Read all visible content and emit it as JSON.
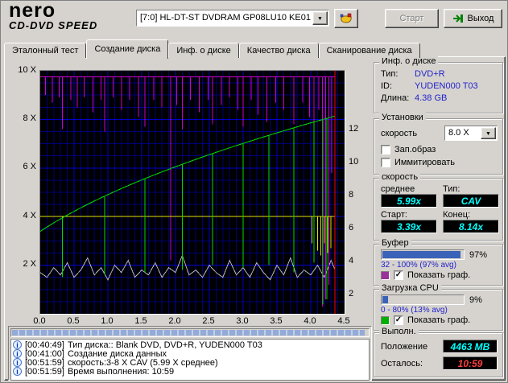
{
  "header": {
    "logo_line1": "nero",
    "logo_line2": "CD-DVD SPEED",
    "drive_combo": {
      "value": "[7:0]   HL-DT-ST DVDRAM GP08LU10 KE01"
    },
    "start_label": "Старт",
    "exit_label": "Выход"
  },
  "tabs": [
    {
      "label": "Эталонный тест",
      "active": false
    },
    {
      "label": "Создание диска",
      "active": true
    },
    {
      "label": "Инф. о диске",
      "active": false
    },
    {
      "label": "Качество диска",
      "active": false
    },
    {
      "label": "Сканирование диска",
      "active": false
    }
  ],
  "chart_data": {
    "type": "line",
    "x_range": [
      0,
      4.5
    ],
    "y_range": [
      0,
      10
    ],
    "left_ticks": [
      "10 X",
      "8 X",
      "6 X",
      "4 X",
      "2 X"
    ],
    "bottom_ticks": [
      "0.0",
      "0.5",
      "1.0",
      "1.5",
      "2.0",
      "2.5",
      "3.0",
      "3.5",
      "4.0",
      "4.5"
    ],
    "right_ticks": [
      "12",
      "10",
      "8",
      "6",
      "4",
      "2"
    ],
    "grid": {
      "minor": "#000078",
      "major": "#0000c8"
    },
    "cursor": {
      "x": 4.36,
      "color": "#ff0000"
    },
    "series": [
      {
        "name": "cpu-usage",
        "color": "#b4b4b4",
        "step": 0.1,
        "values": [
          1.7,
          1.5,
          1.9,
          1.6,
          2.1,
          1.5,
          1.8,
          2.3,
          1.6,
          1.9,
          1.4,
          2.0,
          1.7,
          2.2,
          1.5,
          1.8,
          1.6,
          2.1,
          1.5,
          1.9,
          1.7,
          2.4,
          1.6,
          1.8,
          1.5,
          2.0,
          1.7,
          1.5,
          2.2,
          1.6,
          1.9,
          1.5,
          2.1,
          1.7,
          1.4,
          2.0,
          1.6,
          2.3,
          1.5,
          1.8,
          1.6,
          2.0,
          1.5,
          2.2,
          1.8
        ]
      },
      {
        "name": "buffer-level",
        "color": "#cc00cc",
        "baseline": 9.75,
        "spikes": [
          [
            0.08,
            9.0
          ],
          [
            0.18,
            8.7
          ],
          [
            0.28,
            8.9
          ],
          [
            0.33,
            7.6
          ],
          [
            0.45,
            8.8
          ],
          [
            0.55,
            8.5
          ],
          [
            0.65,
            8.9
          ],
          [
            0.78,
            8.3
          ],
          [
            0.9,
            8.8
          ],
          [
            0.95,
            7.5
          ],
          [
            1.08,
            8.9
          ],
          [
            1.2,
            8.4
          ],
          [
            1.32,
            8.8
          ],
          [
            1.45,
            8.1
          ],
          [
            1.55,
            7.7
          ],
          [
            1.68,
            8.8
          ],
          [
            1.8,
            8.5
          ],
          [
            1.93,
            2.2
          ],
          [
            2.02,
            8.6
          ],
          [
            2.1,
            7.6
          ],
          [
            2.22,
            8.8
          ],
          [
            2.35,
            8.3
          ],
          [
            2.48,
            8.8
          ],
          [
            2.55,
            7.8
          ],
          [
            2.68,
            8.6
          ],
          [
            2.8,
            8.9
          ],
          [
            2.92,
            8.4
          ],
          [
            3.0,
            7.7
          ],
          [
            3.12,
            8.8
          ],
          [
            3.22,
            8.2
          ],
          [
            3.35,
            7.9
          ],
          [
            3.48,
            8.7
          ],
          [
            3.6,
            8.4
          ],
          [
            3.75,
            7.8
          ],
          [
            3.88,
            8.7
          ],
          [
            3.98,
            8.1
          ],
          [
            4.05,
            7.5
          ],
          [
            4.12,
            8.4
          ],
          [
            4.17,
            0.3
          ],
          [
            4.22,
            0.6
          ],
          [
            4.27,
            1.2
          ],
          [
            4.31,
            5.8
          ]
        ]
      },
      {
        "name": "reference-speed",
        "color": "#e0e000",
        "baseline": 4.0,
        "spikes": [
          [
            0.33,
            3.1
          ],
          [
            0.95,
            3.1
          ],
          [
            1.55,
            3.2
          ],
          [
            2.1,
            3.1
          ],
          [
            2.55,
            3.2
          ],
          [
            3.0,
            3.1
          ],
          [
            3.38,
            3.2
          ],
          [
            3.75,
            3.1
          ],
          [
            4.02,
            2.9
          ],
          [
            4.1,
            2.6
          ],
          [
            4.15,
            2.4
          ],
          [
            4.2,
            2.9
          ],
          [
            4.25,
            2.5
          ],
          [
            4.3,
            2.7
          ]
        ]
      },
      {
        "name": "write-speed",
        "color": "#00dc00",
        "cav": {
          "start": 3.39,
          "end": 8.14,
          "length": 4.36
        },
        "spikes": [
          [
            0.33,
            1.5
          ],
          [
            0.95,
            1.6
          ],
          [
            1.55,
            1.7
          ],
          [
            2.1,
            1.8
          ],
          [
            2.55,
            2.0
          ],
          [
            3.0,
            1.9
          ],
          [
            3.38,
            2.0
          ],
          [
            3.75,
            1.7
          ],
          [
            4.05,
            2.1
          ],
          [
            4.18,
            0.4
          ],
          [
            4.24,
            0.6
          ]
        ]
      }
    ]
  },
  "disc_info": {
    "title": "Инф. о диске",
    "rows": [
      {
        "label": "Тип:",
        "value": "DVD+R"
      },
      {
        "label": "ID:",
        "value": "YUDEN000 T03"
      },
      {
        "label": "Длина:",
        "value": "4.38 GB"
      }
    ]
  },
  "settings": {
    "title": "Установки",
    "speed_label": "скорость",
    "speed_value": "8.0 X",
    "checkboxes": [
      {
        "label": "Зап.образ",
        "checked": false
      },
      {
        "label": "Иммитировать",
        "checked": false
      }
    ]
  },
  "speed_box": {
    "title": "скорость",
    "avg_label": "среднее",
    "avg": "5.99x",
    "type_label": "Тип:",
    "type": "CAV",
    "start_label": "Старт:",
    "start": "3.39x",
    "end_label": "Конец:",
    "end": "8.14x"
  },
  "buffer": {
    "title": "Буфер",
    "percent": 97,
    "percent_label": "97%",
    "range": "32 - 100% (97% avg)",
    "show_label": "Показать граф.",
    "checked": true,
    "color": "#993399"
  },
  "cpu": {
    "title": "Загрузка CPU",
    "percent": 9,
    "percent_label": "9%",
    "range": "0 - 80% (13% avg)",
    "show_label": "Показать граф.",
    "checked": true,
    "color": "#00b000"
  },
  "progress": {
    "title": "Выполн.",
    "position_label": "Положение",
    "position": "4463 MB",
    "remaining_label": "Осталось:",
    "remaining": "10:59"
  },
  "log": {
    "progress_percent": 99,
    "entries": [
      {
        "time": "[00:40:49]",
        "text": "Тип диска:: Blank DVD, DVD+R, YUDEN000 T03"
      },
      {
        "time": "[00:41:00]",
        "text": "Создание диска данных"
      },
      {
        "time": "[00:51:59]",
        "text": "скорость:3-8 X CAV (5.99 X среднее)"
      },
      {
        "time": "[00:51:59]",
        "text": "Время выполнения: 10:59"
      }
    ]
  }
}
